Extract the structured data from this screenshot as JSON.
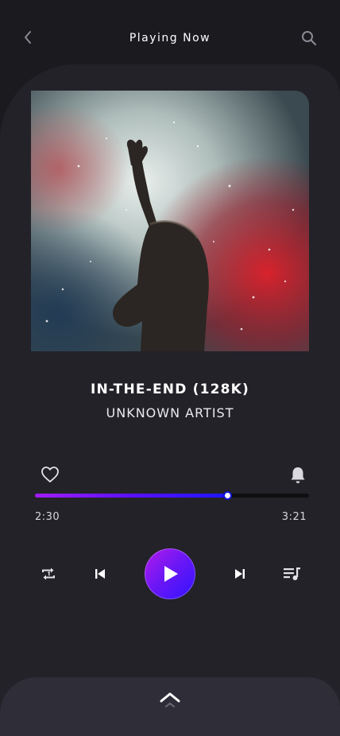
{
  "header": {
    "title": "Playing Now",
    "back_icon": "chevron-left-icon",
    "search_icon": "search-icon"
  },
  "track": {
    "title": "IN-THE-END (128K)",
    "artist": "UNKNOWN ARTIST",
    "artwork": "concert singer with raised hand amid smoke and red light"
  },
  "actions": {
    "favorite_icon": "heart-outline-icon",
    "notify_icon": "bell-icon"
  },
  "progress": {
    "elapsed": "2:30",
    "total": "3:21",
    "fraction": 0.7
  },
  "controls": {
    "repeat_icon": "repeat-one-icon",
    "previous_icon": "skip-previous-icon",
    "play_icon": "play-icon",
    "next_icon": "skip-next-icon",
    "queue_icon": "queue-music-icon"
  },
  "bottom_sheet": {
    "expand_icon": "chevron-up-icon"
  },
  "colors": {
    "background": "#1b1a1f",
    "panel": "#232229",
    "accent_start": "#a31dff",
    "accent_end": "#1e16ff",
    "sheet": "#2e2d38"
  }
}
